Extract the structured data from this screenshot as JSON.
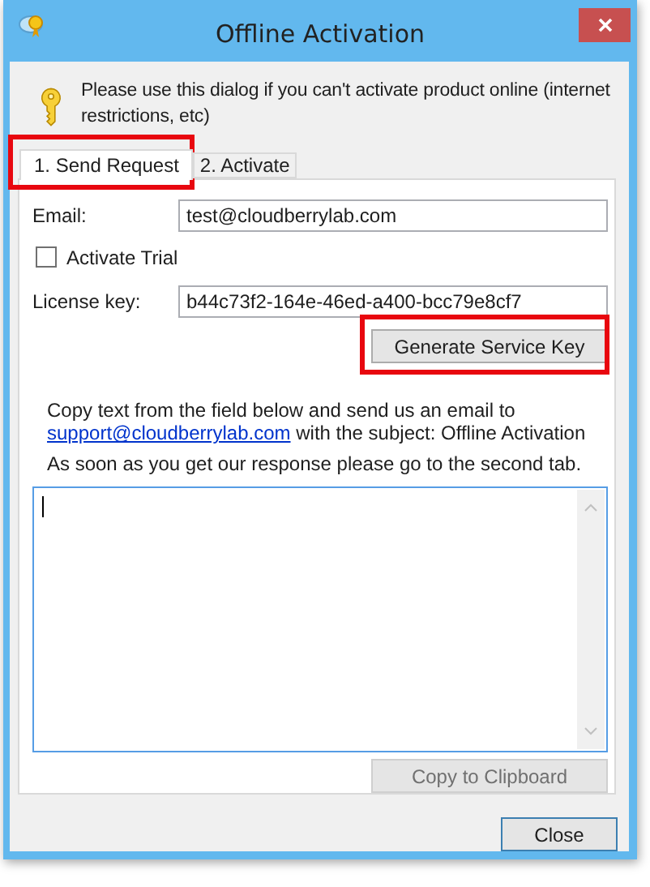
{
  "window": {
    "title": "Offline Activation"
  },
  "intro": "Please use this dialog if you can't activate product online (internet restrictions, etc)",
  "tabs": [
    {
      "label": "1. Send Request",
      "selected": true,
      "highlighted": true
    },
    {
      "label": "2. Activate",
      "selected": false,
      "highlighted": false
    }
  ],
  "email": {
    "label": "Email:",
    "value": "test@cloudberrylab.com"
  },
  "trial": {
    "label": "Activate Trial",
    "checked": false
  },
  "license": {
    "label": "License key:",
    "value": "b44c73f2-164e-46ed-a400-bcc79e8cf7"
  },
  "generate_button": {
    "label": "Generate Service Key",
    "highlighted": true
  },
  "instructions": {
    "before": "Copy text from the field below and send us an email to",
    "link": "support@cloudberrylab.com",
    "after": "with the subject: Offline Activation"
  },
  "note": "As soon as you get our response please go to the second tab.",
  "copy_button": {
    "label": "Copy to Clipboard",
    "disabled": true
  },
  "close_button": {
    "label": "Close"
  }
}
